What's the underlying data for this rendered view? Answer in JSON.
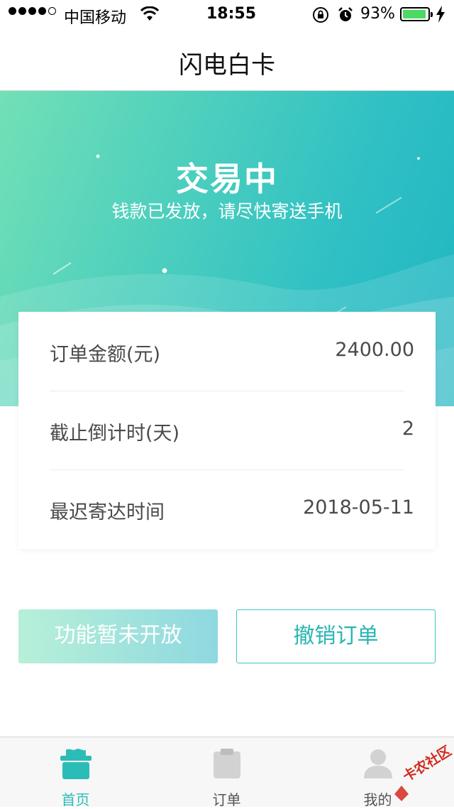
{
  "status_bar": {
    "carrier": "中国移动",
    "time": "18:55",
    "battery_percent": "93%",
    "battery_level": 0.93,
    "signal_bars": 4
  },
  "nav": {
    "title": "闪电白卡"
  },
  "hero": {
    "title": "交易中",
    "subtitle": "钱款已发放，请尽快寄送手机"
  },
  "order": {
    "rows": [
      {
        "label": "订单金额(元)",
        "value": "2400.00"
      },
      {
        "label": "截止倒计时(天)",
        "value": "2"
      },
      {
        "label": "最迟寄达时间",
        "value": "2018-05-11"
      }
    ]
  },
  "actions": {
    "disabled_label": "功能暂未开放",
    "cancel_label": "撤销订单"
  },
  "tabs": [
    {
      "label": "首页",
      "icon": "home-icon",
      "active": true
    },
    {
      "label": "订单",
      "icon": "order-icon",
      "active": false
    },
    {
      "label": "我的",
      "icon": "profile-icon",
      "active": false
    }
  ],
  "watermark": {
    "text": "卡农社区"
  },
  "colors": {
    "accent": "#2bbcb8",
    "hero_start": "#72e0b6",
    "hero_end": "#1fb5c2",
    "battery": "#4cd964"
  }
}
